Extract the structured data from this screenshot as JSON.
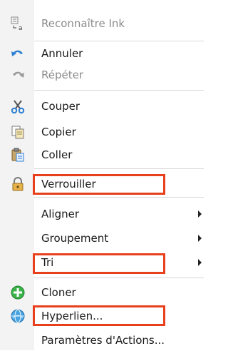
{
  "menu": {
    "items": [
      {
        "label": "Reconnaître Ink",
        "icon": "ink-recognize-icon",
        "disabled": true
      },
      {
        "label": "Annuler",
        "icon": "undo-icon"
      },
      {
        "label": "Répéter",
        "icon": "redo-icon",
        "disabled": true
      },
      {
        "label": "Couper",
        "icon": "cut-icon"
      },
      {
        "label": "Copier",
        "icon": "copy-icon"
      },
      {
        "label": "Coller",
        "icon": "paste-icon"
      },
      {
        "label": "Verrouiller",
        "icon": "lock-icon"
      },
      {
        "label": "Aligner",
        "submenu": true
      },
      {
        "label": "Groupement",
        "submenu": true
      },
      {
        "label": "Tri",
        "submenu": true
      },
      {
        "label": "Cloner",
        "icon": "clone-plus-icon"
      },
      {
        "label": "Hyperlien...",
        "icon": "hyperlink-globe-icon"
      },
      {
        "label": "Paramètres d'Actions..."
      }
    ]
  },
  "colors": {
    "highlight_box": "#e8401c",
    "disabled_text": "#8c8c8c"
  }
}
